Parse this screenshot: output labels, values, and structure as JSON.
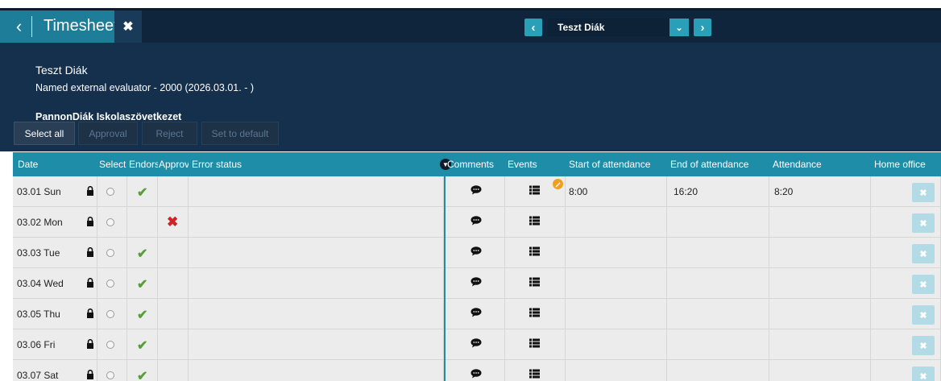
{
  "header": {
    "title": "Timesheet",
    "selected_person": "Teszt Diák",
    "person_name": "Teszt Diák",
    "person_role": "Named external evaluator - 2000 (2026.03.01. - )",
    "organization": "PannonDiák Iskolaszövetkezet"
  },
  "toolbar": {
    "select_all": "Select all",
    "approval": "Approval",
    "reject": "Reject",
    "set_default": "Set to default"
  },
  "columns": {
    "date": "Date",
    "select": "Select",
    "endorse": "Endorsement",
    "approval": "Approval",
    "error_status": "Error status",
    "comments": "Comments",
    "events": "Events",
    "start": "Start of attendance",
    "end": "End of attendance",
    "attendance": "Attendance",
    "home_office": "Home office"
  },
  "rows": [
    {
      "date": "03.01 Sun",
      "endorsed": true,
      "rejected": false,
      "start": "8:00",
      "end": "16:20",
      "attendance": "8:20",
      "event_flag": true
    },
    {
      "date": "03.02 Mon",
      "endorsed": false,
      "rejected": true,
      "start": "",
      "end": "",
      "attendance": "",
      "event_flag": false
    },
    {
      "date": "03.03 Tue",
      "endorsed": true,
      "rejected": false,
      "start": "",
      "end": "",
      "attendance": "",
      "event_flag": false
    },
    {
      "date": "03.04 Wed",
      "endorsed": true,
      "rejected": false,
      "start": "",
      "end": "",
      "attendance": "",
      "event_flag": false
    },
    {
      "date": "03.05 Thu",
      "endorsed": true,
      "rejected": false,
      "start": "",
      "end": "",
      "attendance": "",
      "event_flag": false
    },
    {
      "date": "03.06 Fri",
      "endorsed": true,
      "rejected": false,
      "start": "",
      "end": "",
      "attendance": "",
      "event_flag": false
    },
    {
      "date": "03.07 Sat",
      "endorsed": true,
      "rejected": false,
      "start": "",
      "end": "",
      "attendance": "",
      "event_flag": false
    }
  ],
  "icons": {
    "back": "chevron-left-icon",
    "close": "close-icon",
    "prev": "chevron-left-icon",
    "next": "chevron-right-icon",
    "lock": "lock-icon",
    "check": "check-icon",
    "reject": "x-icon",
    "comment": "comment-icon",
    "events": "list-icon",
    "edit": "pencil-icon",
    "filter": "filter-icon"
  },
  "colors": {
    "header_bg": "#15304c",
    "accent": "#1e8da8",
    "check": "#5a9e3c",
    "reject": "#d02424",
    "flag": "#f0a020"
  }
}
